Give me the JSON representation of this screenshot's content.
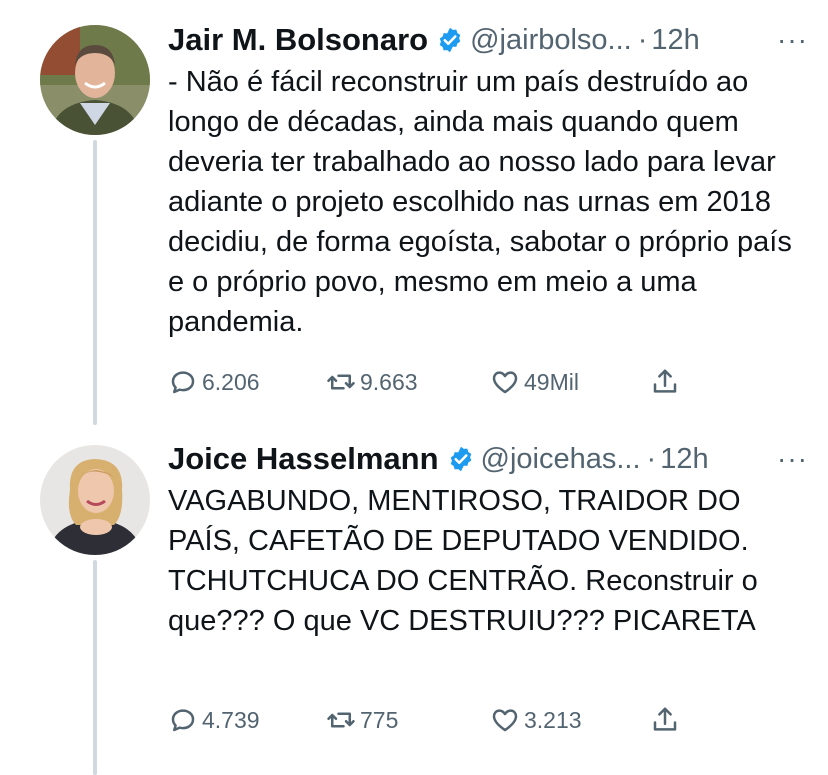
{
  "tweets": [
    {
      "name": "Jair M. Bolsonaro",
      "handle": "@jairbolso...",
      "separator": "·",
      "time": "12h",
      "more": "···",
      "text": "- Não é fácil reconstruir um país destruído ao longo de décadas, ainda mais quando quem deveria ter trabalhado ao nosso lado para levar adiante o projeto escolhido nas urnas em 2018 decidiu, de forma egoísta, sabotar o próprio país e o próprio povo, mesmo em meio a uma pandemia.",
      "replies": "6.206",
      "retweets": "9.663",
      "likes": "49Mil"
    },
    {
      "name": "Joice Hasselmann",
      "handle": "@joicehas...",
      "separator": "·",
      "time": "12h",
      "more": "···",
      "text": "VAGABUNDO, MENTIROSO, TRAIDOR DO PAÍS, CAFETÃO DE DEPUTADO VENDIDO. TCHUTCHUCA DO CENTRÃO. Reconstruir o que??? O que VC DESTRUIU??? PICARETA",
      "replies": "4.739",
      "retweets": "775",
      "likes": "3.213"
    }
  ],
  "colors": {
    "text": "#0f1419",
    "secondary": "#536471",
    "verified": "#1d9bf0",
    "thread_line": "#cfd9de"
  },
  "icons": [
    "verified-badge-icon",
    "reply-icon",
    "retweet-icon",
    "like-icon",
    "share-icon",
    "more-icon"
  ]
}
